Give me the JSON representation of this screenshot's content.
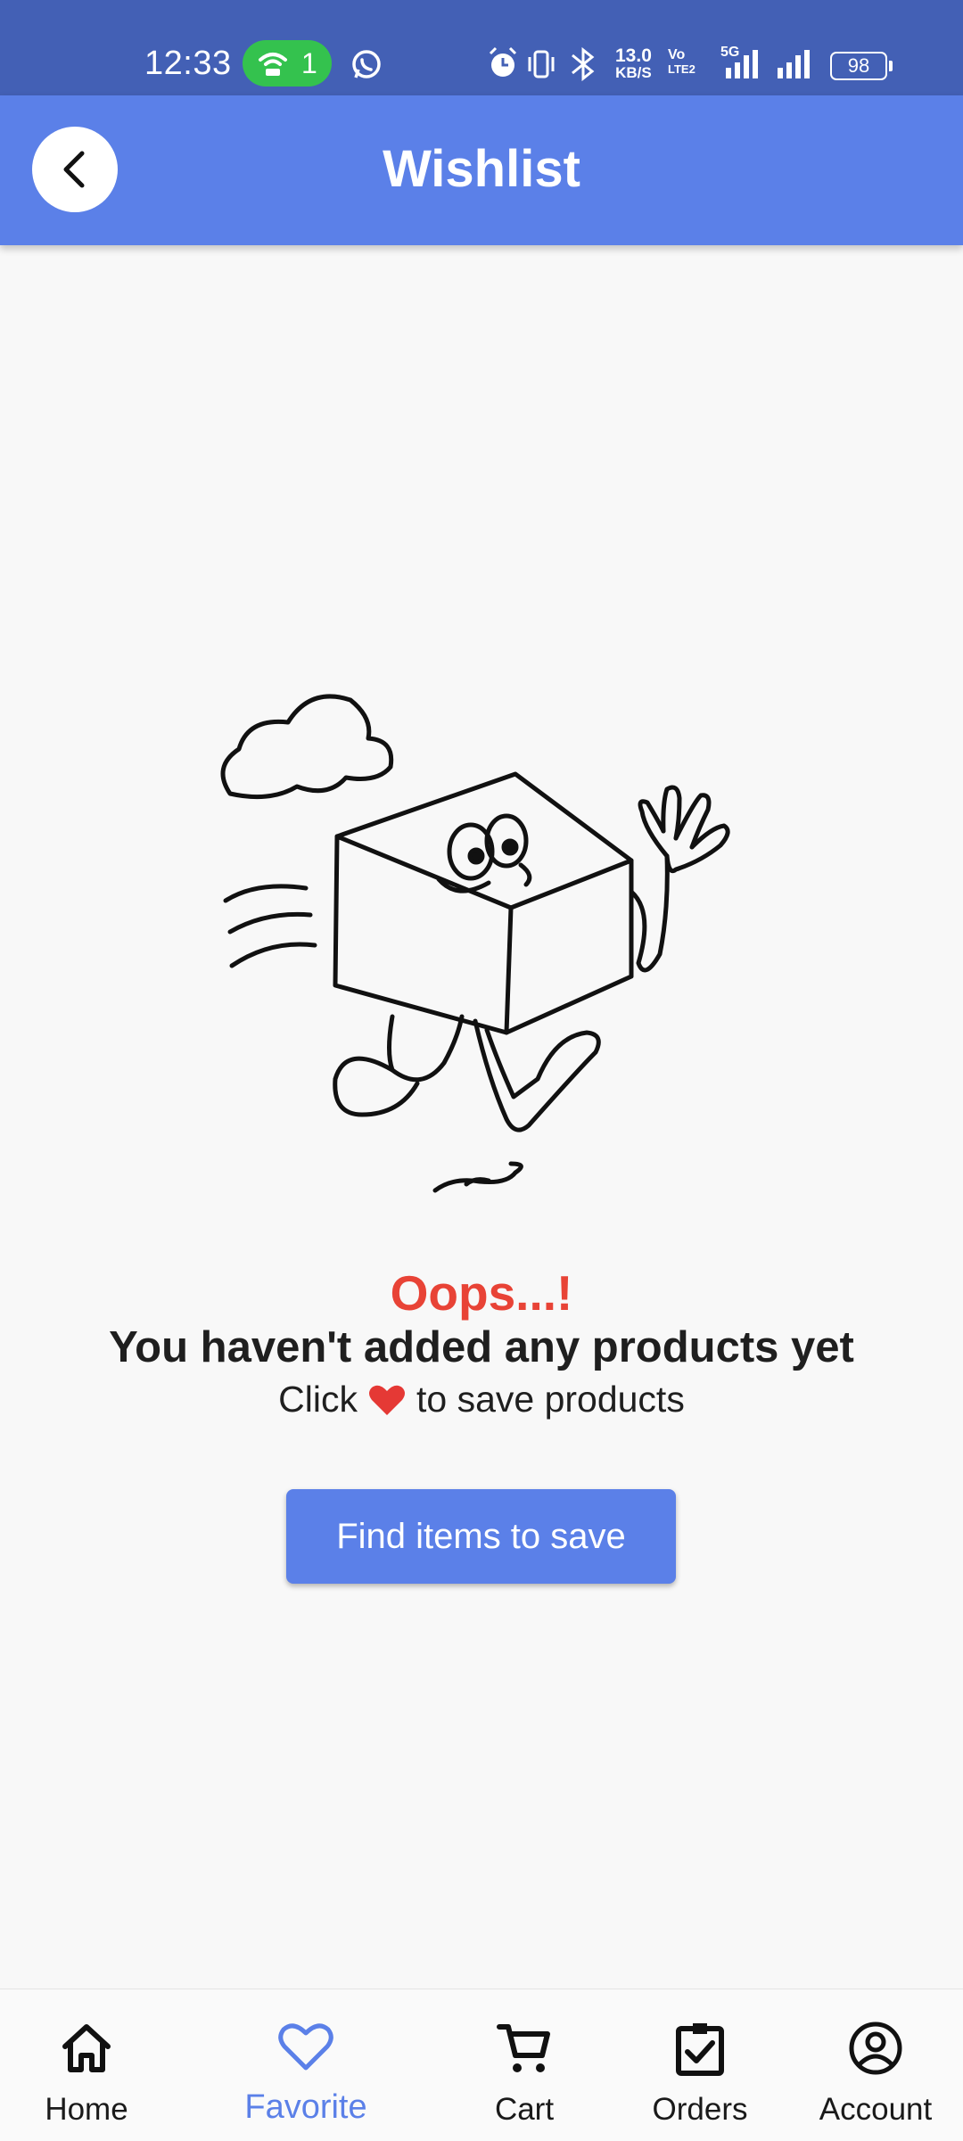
{
  "status_bar": {
    "time": "12:33",
    "hotspot_count": "1",
    "net_speed_value": "13.0",
    "net_speed_unit": "KB/S",
    "volte_label_1": "Vo",
    "volte_label_2": "LTE2",
    "signal_label": "5G",
    "battery": "98"
  },
  "app_bar": {
    "title": "Wishlist",
    "back_icon": "chevron-left-icon"
  },
  "empty_state": {
    "illustration": "running-box-character-waving",
    "headline": "Oops...!",
    "message": "You haven't added any products yet",
    "hint_prefix": "Click",
    "hint_icon": "heart-icon",
    "hint_suffix": "to save products",
    "button_label": "Find items to save"
  },
  "bottom_nav": {
    "active": "Favorite",
    "items": [
      {
        "label": "Home",
        "icon": "home-icon"
      },
      {
        "label": "Favorite",
        "icon": "heart-outline-icon"
      },
      {
        "label": "Cart",
        "icon": "cart-icon"
      },
      {
        "label": "Orders",
        "icon": "clipboard-check-icon"
      },
      {
        "label": "Account",
        "icon": "account-circle-icon"
      }
    ]
  },
  "colors": {
    "status_bar": "#4360b5",
    "app_bar": "#5b80e8",
    "accent": "#5b80e8",
    "headline": "#e84336",
    "heart": "#e53935",
    "background": "#f8f8f8"
  }
}
